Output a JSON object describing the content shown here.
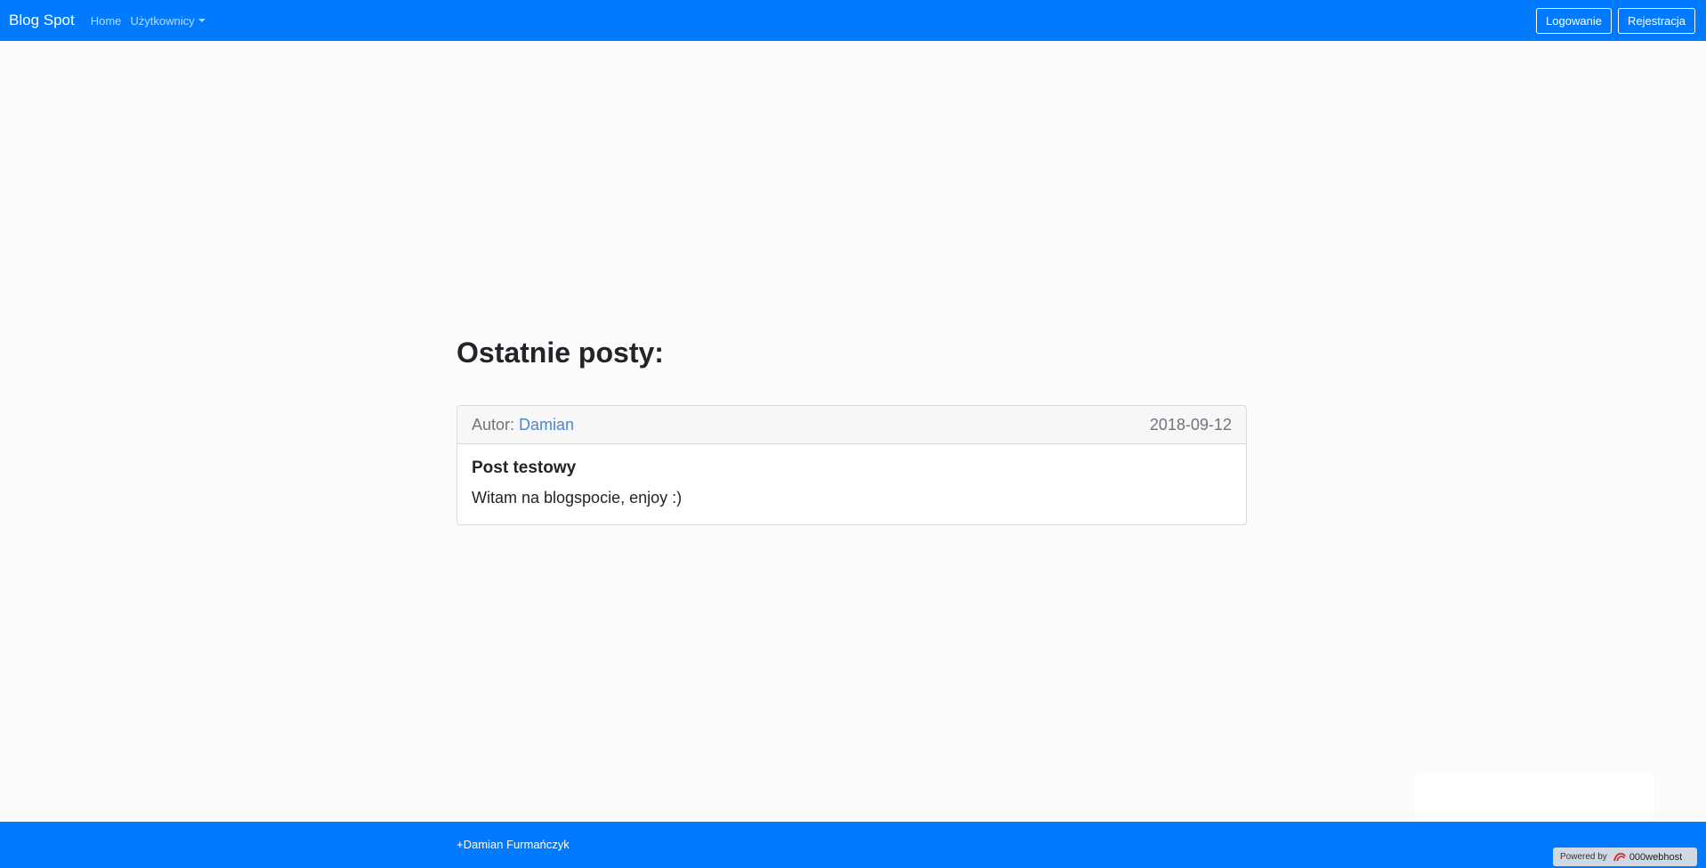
{
  "navbar": {
    "brand": "Blog Spot",
    "home": "Home",
    "users": "Użytkownicy",
    "login": "Logowanie",
    "register": "Rejestracja"
  },
  "main": {
    "heading": "Ostatnie posty:",
    "posts": [
      {
        "author_label": "Autor:",
        "author": "Damian",
        "date": "2018-09-12",
        "title": "Post testowy",
        "body": "Witam na blogspocie, enjoy :)"
      }
    ]
  },
  "footer": {
    "author_link": "+Damian Furmańczyk",
    "powered_by": "Powered by",
    "host_name": "000webhost"
  },
  "colors": {
    "primary": "#007bff",
    "link": "#4a86d6"
  }
}
